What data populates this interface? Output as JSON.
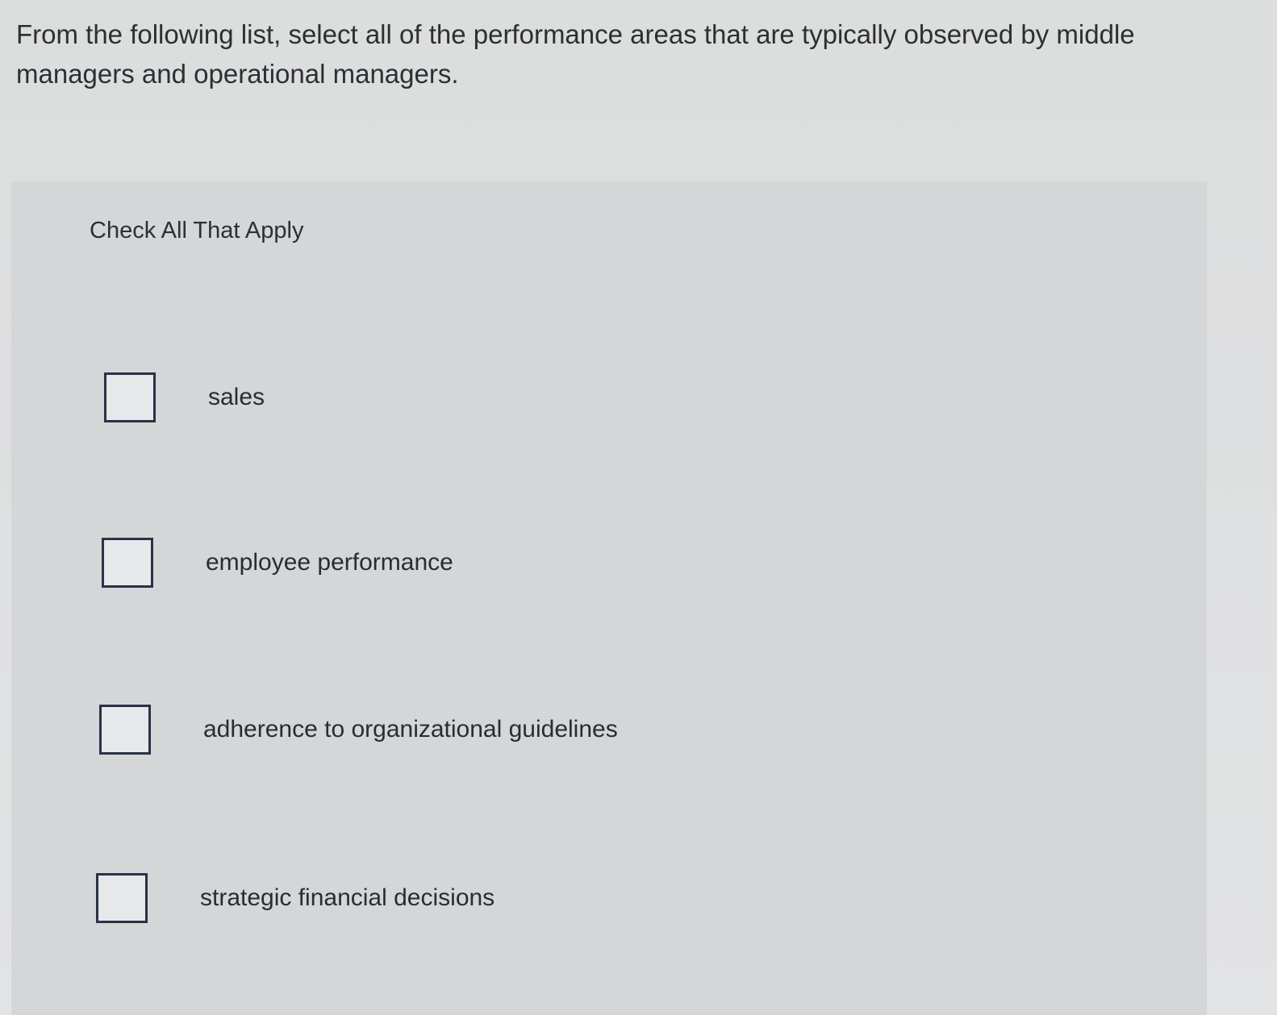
{
  "question": {
    "text": "From the following list, select all of the performance areas that are typically observed by middle managers and operational managers."
  },
  "instruction": "Check All That Apply",
  "options": [
    {
      "label": "sales",
      "checked": false
    },
    {
      "label": "employee performance",
      "checked": false
    },
    {
      "label": "adherence to organizational guidelines",
      "checked": false
    },
    {
      "label": "strategic financial decisions",
      "checked": false
    }
  ]
}
